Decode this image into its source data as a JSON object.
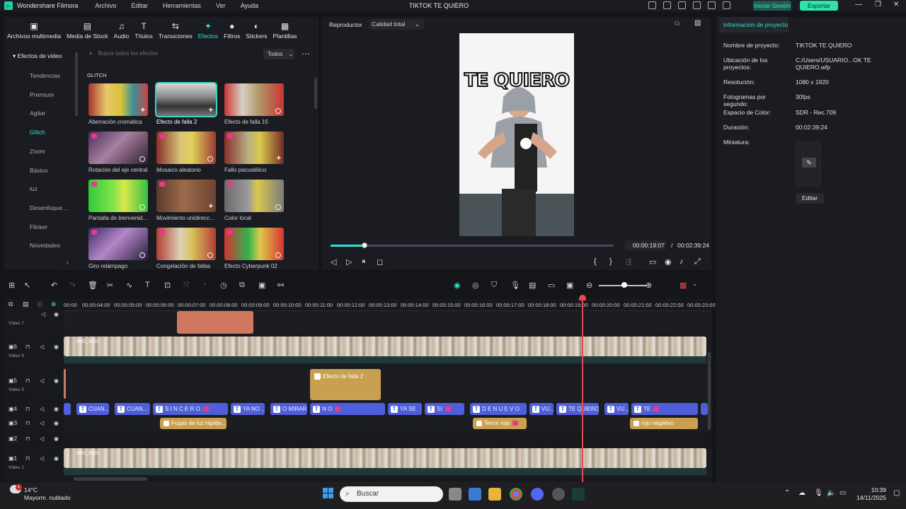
{
  "titlebar": {
    "app_name": "Wondershare Filmora",
    "menu": [
      "Archivo",
      "Editar",
      "Herramientas",
      "Ver",
      "Ayuda"
    ],
    "project_title": "TIKTOK TE QUIERO",
    "login": "Iniciar Sesión",
    "export": "Exportar"
  },
  "toolbar": {
    "items": [
      "Archivos multimedia",
      "Media de Stock",
      "Audio",
      "Títulos",
      "Transiciones",
      "Efectos",
      "Filtros",
      "Stickers",
      "Plantillas"
    ],
    "active": "Efectos"
  },
  "sidebar": {
    "title": "Efectos de video",
    "items": [
      "Tendencias",
      "Premium",
      "Agitar",
      "Glitch",
      "Zoom",
      "Básico",
      "luz",
      "Desenfoque...",
      "Flicker",
      "Novedades"
    ],
    "active": "Glitch"
  },
  "effects": {
    "search_placeholder": "Busca todos los efectos",
    "filter": "Todos",
    "section": "GLITCH",
    "items": [
      "Aberración cromática",
      "Efecto de falla 2",
      "Efecto de falla 15",
      "Rotación del eje central",
      "Mosaico aleatorio",
      "Fallo psicodélico",
      "Pantalla de bienvenid...",
      "Movimiento unidirecc...",
      "Color local",
      "Giro relámpago",
      "Congelación de fallas",
      "Efecto Cyberpunk 02"
    ]
  },
  "player": {
    "label": "Reproductor",
    "quality": "Calidad total",
    "overlay_text": "TE QUIERO",
    "current_time": "00:00:19:07",
    "separator": "/",
    "total_time": "00:02:39:24",
    "progress": 0.12
  },
  "info": {
    "tab": "Información de proyecto",
    "rows": [
      {
        "key": "Nombre de proyecto:",
        "value": "TIKTOK TE QUIERO"
      },
      {
        "key": "Ubicación de los proyectos:",
        "value": "C:/Users/USUARIO...OK TE QUIERO.wfp"
      },
      {
        "key": "Resolución:",
        "value": "1080 x 1920"
      },
      {
        "key": "Fotogramas por segundo:",
        "value": "30fps"
      },
      {
        "key": "Espacio de Color:",
        "value": "SDR - Rec.709"
      },
      {
        "key": "Duración:",
        "value": "00:02:39:24"
      },
      {
        "key": "Miniatura:",
        "value": ""
      }
    ],
    "edit": "Editar"
  },
  "timeline": {
    "ruler": [
      "00:00",
      "00:00:04:00",
      "00:00:05:00",
      "00:00:06:00",
      "00:00:07:00",
      "00:00:08:00",
      "00:00:09:00",
      "00:00:10:00",
      "00:00:11:00",
      "00:00:12:00",
      "00:00:13:00",
      "00:00:14:00",
      "00:00:15:00",
      "00:00:16:00",
      "00:00:17:00",
      "00:00:18:00",
      "00:00:19:00",
      "00:00:20:00",
      "00:00:21:00",
      "00:00:22:00",
      "00:00:23:00"
    ],
    "tracks": [
      "Video 7",
      "Video 6",
      "Video 5",
      "4",
      "3",
      "2",
      "Video 1"
    ],
    "video_clip_label": "IMG_5831",
    "fx_clip": "Efecto de falla 2",
    "text_clips": [
      "CUAN...",
      "CUAN...",
      "S I N C E R O",
      "YA NO ...",
      "O MIRAR",
      "N O",
      "YA SE",
      "SI",
      "D E   N U E V O",
      "VU...",
      "TE QUIERO",
      "VU...",
      "TE"
    ],
    "fx3_clips": [
      "Fugas de luz rápida...",
      "Terror rojo",
      "rojo negativo"
    ]
  },
  "taskbar": {
    "temp": "14°C",
    "weather": "Mayorm. nublado",
    "search": "Buscar",
    "time": "10:39",
    "date": "14/11/2025"
  }
}
